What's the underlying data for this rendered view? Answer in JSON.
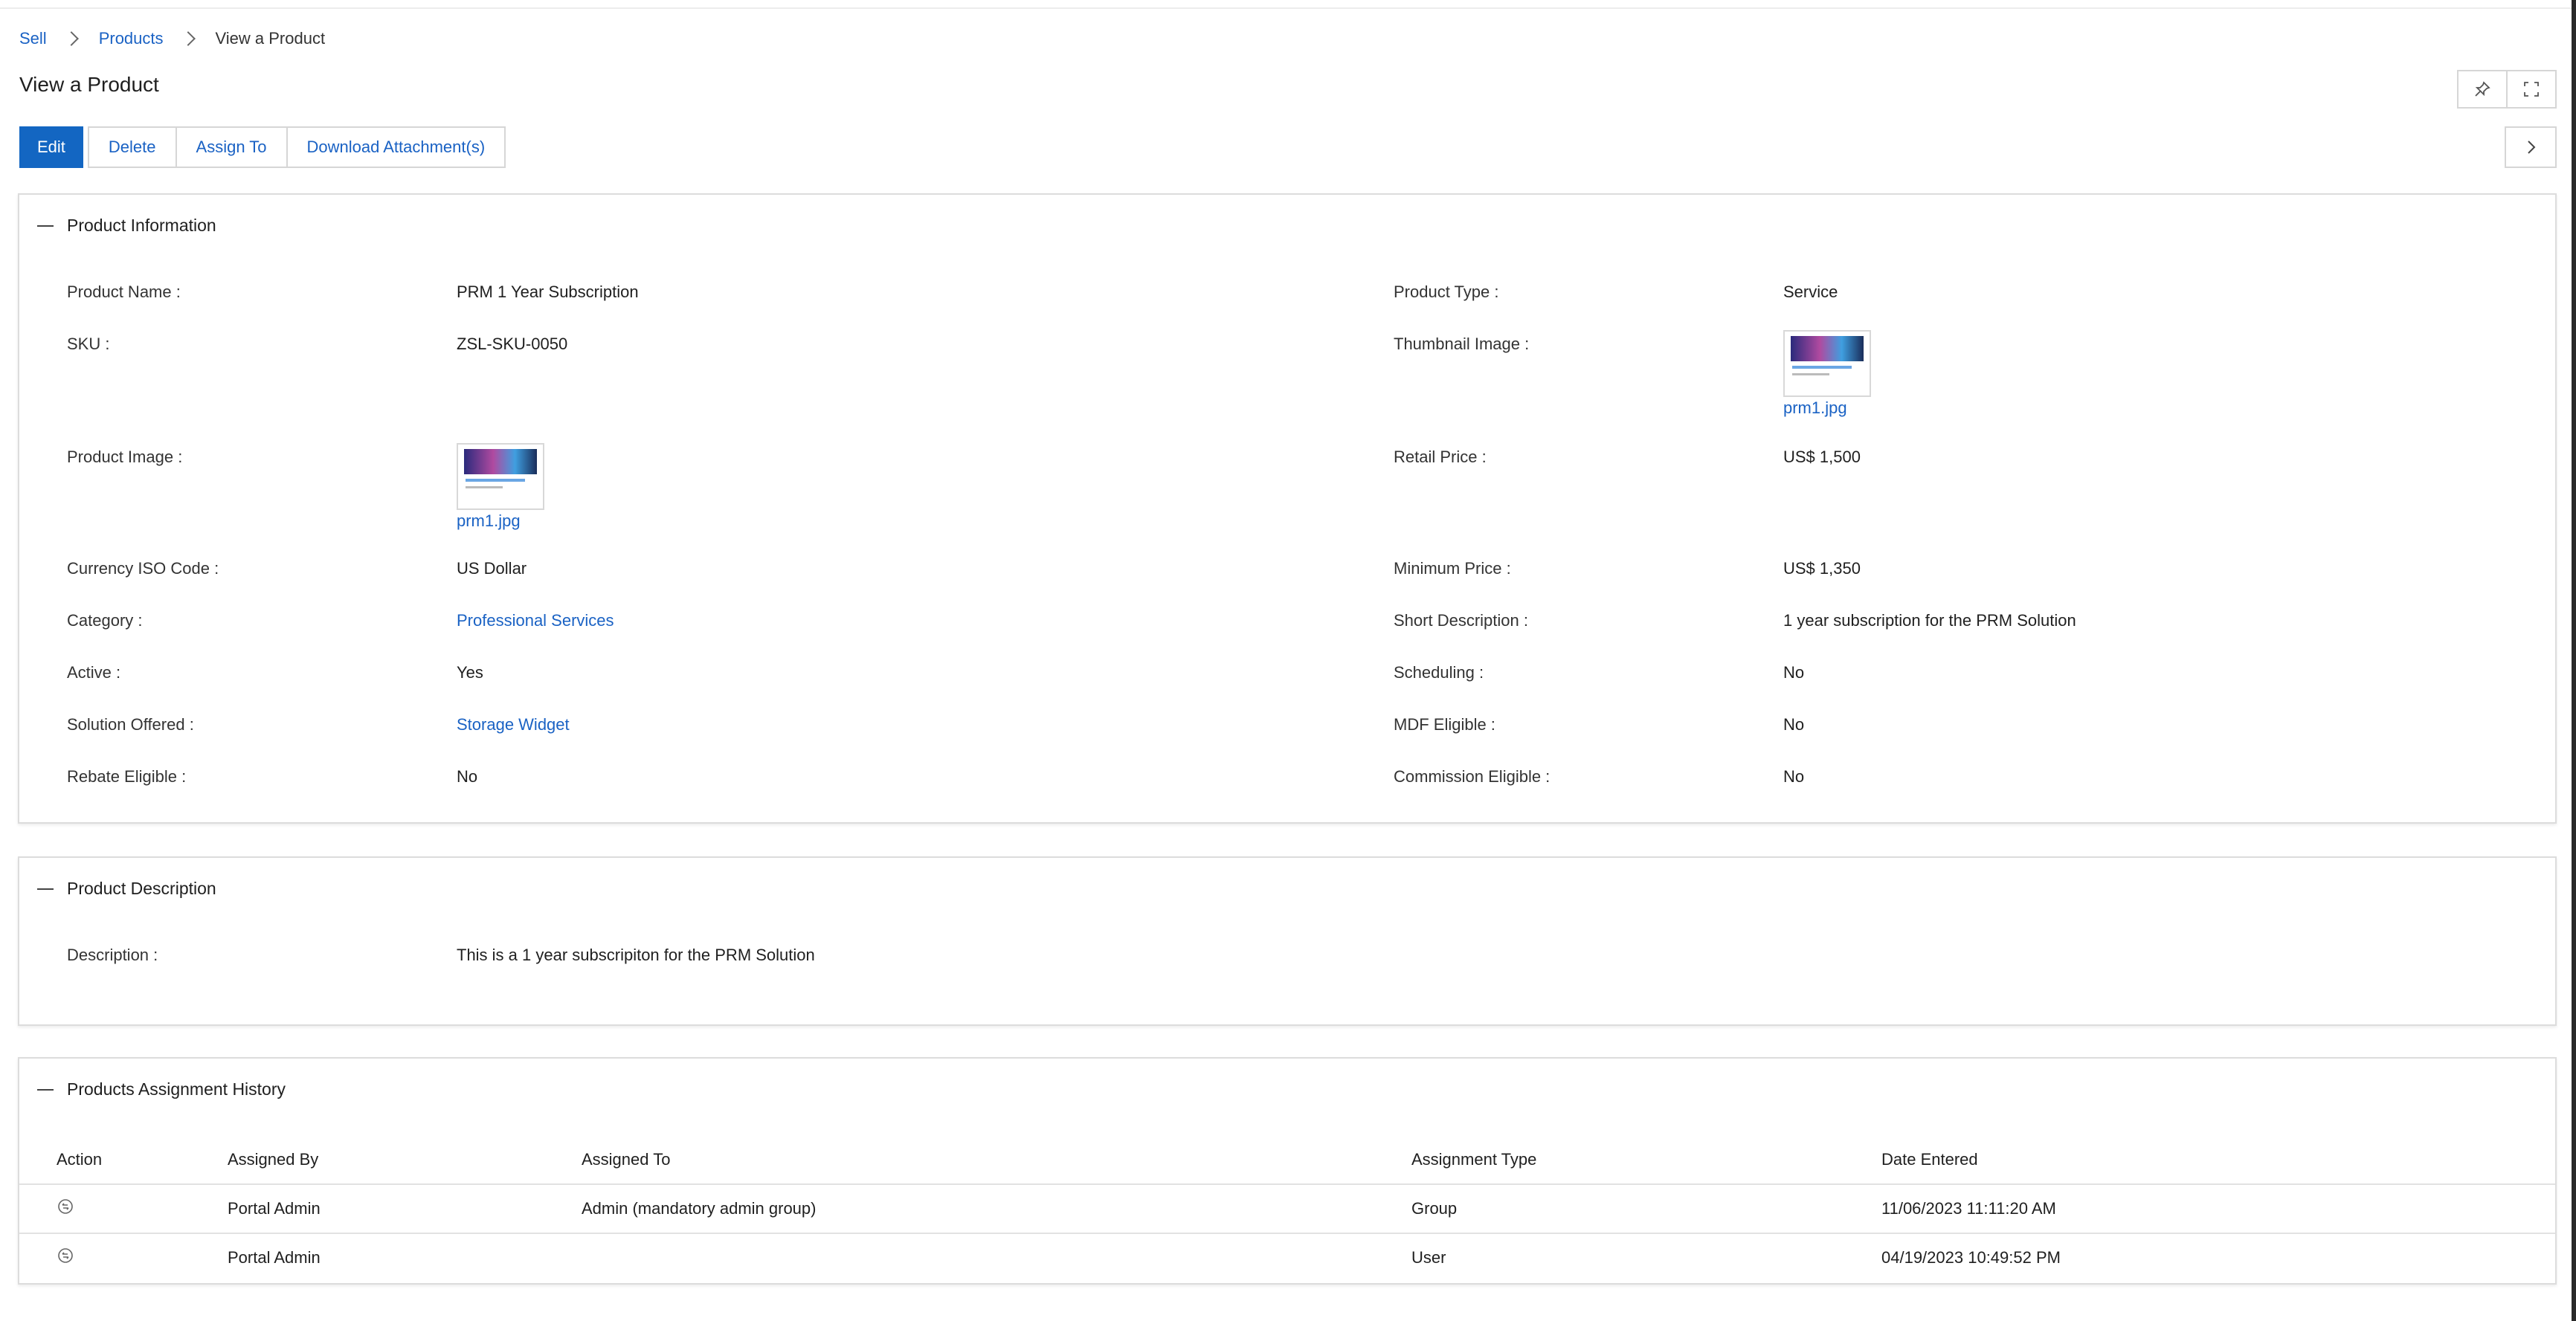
{
  "breadcrumb": {
    "items": [
      "Sell",
      "Products"
    ],
    "current": "View a Product"
  },
  "page_title": "View a Product",
  "toolbar": {
    "edit": "Edit",
    "delete": "Delete",
    "assign_to": "Assign To",
    "download": "Download Attachment(s)"
  },
  "icons": {
    "pin": "pin-icon",
    "expand": "expand-icon",
    "next": "chevron-right-icon",
    "collapse": "minus-icon",
    "history": "history-icon"
  },
  "product_info": {
    "title": "Product Information",
    "product_name_label": "Product Name :",
    "product_name": "PRM 1 Year Subscription",
    "product_type_label": "Product Type :",
    "product_type": "Service",
    "sku_label": "SKU :",
    "sku": "ZSL-SKU-0050",
    "thumbnail_label": "Thumbnail Image :",
    "thumbnail_file": "prm1.jpg",
    "product_image_label": "Product Image :",
    "product_image_file": "prm1.jpg",
    "retail_price_label": "Retail Price :",
    "retail_price": "US$ 1,500",
    "currency_label": "Currency ISO Code :",
    "currency": "US Dollar",
    "min_price_label": "Minimum Price :",
    "min_price": "US$ 1,350",
    "category_label": "Category :",
    "category": "Professional Services",
    "short_desc_label": "Short Description :",
    "short_desc": "1 year subscription for the PRM Solution",
    "active_label": "Active :",
    "active": "Yes",
    "scheduling_label": "Scheduling :",
    "scheduling": "No",
    "solution_label": "Solution Offered :",
    "solution": "Storage Widget",
    "mdf_label": "MDF Eligible :",
    "mdf": "No",
    "rebate_label": "Rebate Eligible :",
    "rebate": "No",
    "commission_label": "Commission Eligible :",
    "commission": "No"
  },
  "product_desc": {
    "title": "Product Description",
    "description_label": "Description :",
    "description": "This is a 1 year subscripiton for the PRM Solution"
  },
  "history": {
    "title": "Products Assignment History",
    "columns": [
      "Action",
      "Assigned By",
      "Assigned To",
      "Assignment Type",
      "Date Entered"
    ],
    "rows": [
      {
        "assigned_by": "Portal Admin",
        "assigned_to": "Admin (mandatory admin group)",
        "type": "Group",
        "date": "11/06/2023 11:11:20 AM"
      },
      {
        "assigned_by": "Portal Admin",
        "assigned_to": "",
        "type": "User",
        "date": "04/19/2023 10:49:52 PM"
      }
    ]
  },
  "colors": {
    "accent": "#1366c2",
    "link": "#1a62c4",
    "border": "#dcdcdc"
  }
}
